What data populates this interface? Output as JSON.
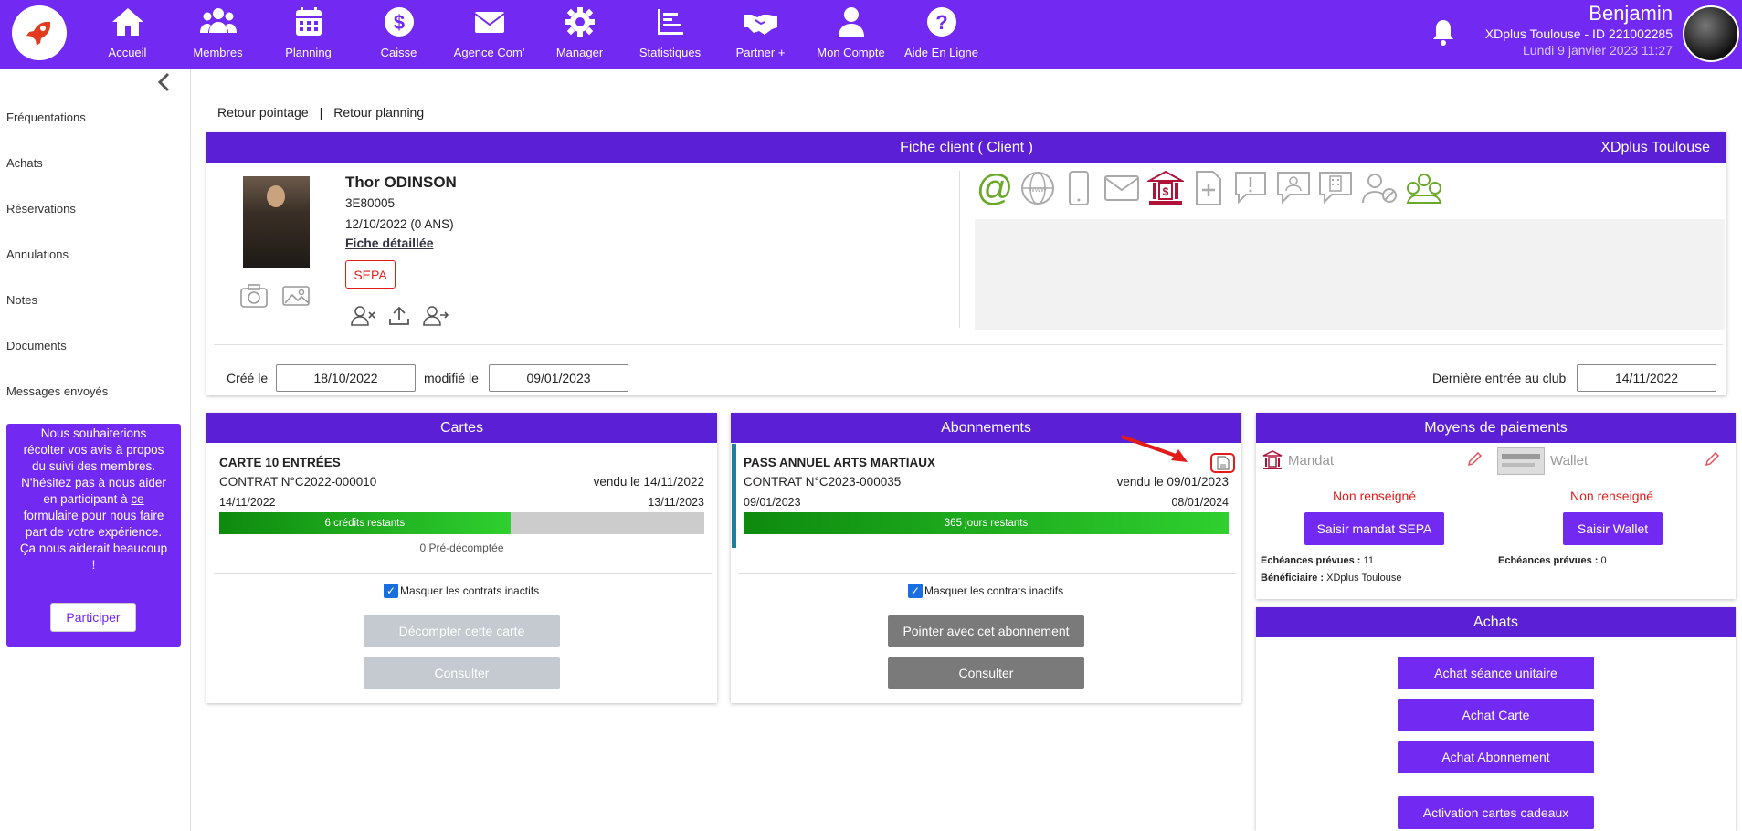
{
  "topbar": {
    "nav": [
      {
        "label": "Accueil",
        "icon": "home-icon"
      },
      {
        "label": "Membres",
        "icon": "users-icon"
      },
      {
        "label": "Planning",
        "icon": "calendar-icon"
      },
      {
        "label": "Caisse",
        "icon": "dollar-icon"
      },
      {
        "label": "Agence Com'",
        "icon": "mail-icon"
      },
      {
        "label": "Manager",
        "icon": "gear-icon"
      },
      {
        "label": "Statistiques",
        "icon": "chart-icon"
      },
      {
        "label": "Partner +",
        "icon": "handshake-icon"
      },
      {
        "label": "Mon Compte",
        "icon": "user-icon"
      },
      {
        "label": "Aide En Ligne",
        "icon": "help-icon"
      }
    ],
    "user_name": "Benjamin",
    "club": "XDplus Toulouse - ID 221002285",
    "datetime": "Lundi 9 janvier 2023 11:27"
  },
  "sidebar": {
    "items": [
      "Fréquentations",
      "Achats",
      "Réservations",
      "Annulations",
      "Notes",
      "Documents",
      "Messages envoyés"
    ],
    "feedback_text_1": "Nous souhaiterions récolter vos avis à propos du suivi des membres. N'hésitez pas à nous aider en participant à ",
    "feedback_link": "ce formulaire",
    "feedback_text_2": " pour nous faire part de votre expérience. Ça nous aiderait beaucoup !",
    "participer": "Participer"
  },
  "links": {
    "retour_pointage": "Retour pointage",
    "sep": "|",
    "retour_planning": "Retour planning"
  },
  "fiche": {
    "title": "Fiche client ( Client )",
    "club": "XDplus Toulouse",
    "name": "Thor ODINSON",
    "code": "3E80005",
    "birth": "12/10/2022 (0 ANS)",
    "detail_link": "Fiche détaillée",
    "sepa": "SEPA",
    "cree_label": "Créé le",
    "cree_value": "18/10/2022",
    "modifie_label": "modifié le",
    "modifie_value": "09/01/2023",
    "derniere_label": "Dernière entrée au club",
    "derniere_value": "14/11/2022"
  },
  "cartes": {
    "title": "Cartes",
    "name": "CARTE 10 ENTRÉES",
    "contrat": "CONTRAT N°C2022-000010",
    "vendu": "vendu le 14/11/2022",
    "start": "14/11/2022",
    "end": "13/11/2023",
    "progress_label": "6 crédits restants",
    "progress_fraction": 0.6,
    "pre": "0 Pré-décomptée",
    "masquer": "Masquer les contrats inactifs",
    "btn1": "Décompter cette carte",
    "btn2": "Consulter"
  },
  "abonnements": {
    "title": "Abonnements",
    "name": "PASS ANNUEL ARTS MARTIAUX",
    "contrat": "CONTRAT N°C2023-000035",
    "vendu": "vendu le 09/01/2023",
    "start": "09/01/2023",
    "end": "08/01/2024",
    "progress_label": "365 jours restants",
    "progress_fraction": 1.0,
    "masquer": "Masquer les contrats inactifs",
    "btn1": "Pointer avec cet abonnement",
    "btn2": "Consulter"
  },
  "paiements": {
    "title": "Moyens de paiements",
    "mandat": "Mandat",
    "wallet": "Wallet",
    "non1": "Non renseigné",
    "non2": "Non renseigné",
    "saisir_mandat": "Saisir mandat SEPA",
    "saisir_wallet": "Saisir Wallet",
    "echeances_label": "Echéances prévues :",
    "echeances_mandat": "11",
    "benef_label": "Bénéficiaire :",
    "benef_value": "XDplus Toulouse",
    "echeances_wallet": "0"
  },
  "achats": {
    "title": "Achats",
    "btn1": "Achat séance unitaire",
    "btn2": "Achat Carte",
    "btn3": "Achat Abonnement",
    "btn4": "Activation cartes cadeaux"
  },
  "colors": {
    "brand": "#7229f2",
    "header": "#5b1fd6",
    "danger": "#e21b1b",
    "success": "#2fd02f"
  }
}
